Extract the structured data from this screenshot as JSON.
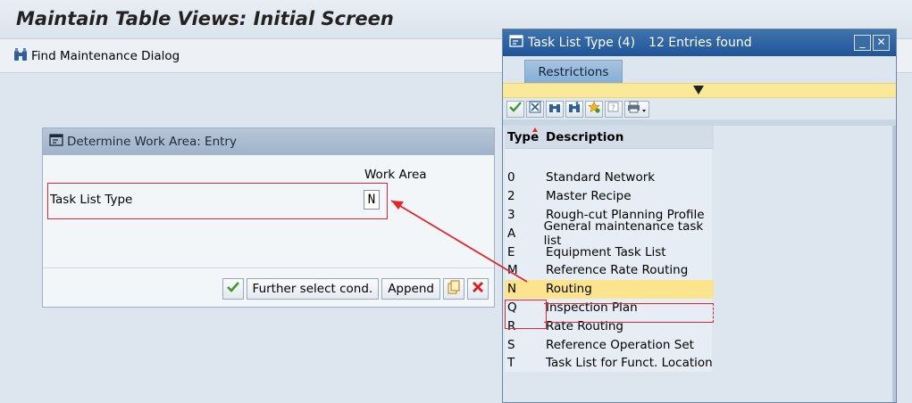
{
  "window": {
    "title": "Maintain Table Views: Initial Screen"
  },
  "toolbar": {
    "find_label": "Find Maintenance Dialog"
  },
  "dialog": {
    "title": "Determine Work Area: Entry",
    "column_header": "Work Area",
    "row_label": "Task List Type",
    "input_value": "N",
    "buttons": {
      "further": "Further select cond.",
      "append": "Append"
    }
  },
  "popup": {
    "title": "Task List Type (4)",
    "entries_found": "12 Entries found",
    "tab_restrictions": "Restrictions",
    "columns": {
      "type": "Type",
      "description": "Description"
    },
    "rows": [
      {
        "type": "0",
        "description": "Standard Network"
      },
      {
        "type": "2",
        "description": "Master Recipe"
      },
      {
        "type": "3",
        "description": "Rough-cut Planning Profile"
      },
      {
        "type": "A",
        "description": "General maintenance task list"
      },
      {
        "type": "E",
        "description": "Equipment Task List"
      },
      {
        "type": "M",
        "description": "Reference Rate Routing"
      },
      {
        "type": "N",
        "description": "Routing"
      },
      {
        "type": "Q",
        "description": "Inspection Plan"
      },
      {
        "type": "R",
        "description": "Rate Routing"
      },
      {
        "type": "S",
        "description": "Reference Operation Set"
      },
      {
        "type": "T",
        "description": "Task List for Funct. Location"
      }
    ],
    "selected_index": 6
  },
  "colors": {
    "accent": "#1f5598",
    "highlight": "#fce48f",
    "annotation": "#e0262e"
  }
}
